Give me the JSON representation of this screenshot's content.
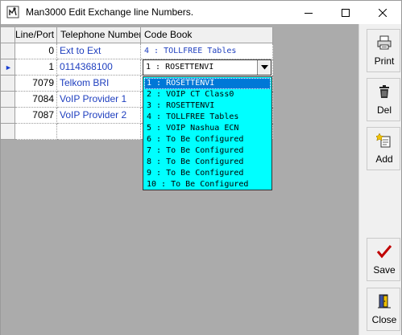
{
  "window": {
    "title": "Man3000 Edit Exchange line Numbers.",
    "buttons": {
      "minimize": "minimize",
      "maximize": "maximize",
      "close": "close"
    }
  },
  "grid": {
    "headers": {
      "line_port": "Line/Port",
      "telephone": "Telephone Number",
      "code_book": "Code Book"
    },
    "rows": [
      {
        "line": "0",
        "telephone": "Ext to Ext",
        "code_book": "4 : TOLLFREE Tables",
        "current": false
      },
      {
        "line": "1",
        "telephone": "0114368100",
        "code_book": "",
        "current": true
      },
      {
        "line": "7079",
        "telephone": "Telkom BRI",
        "code_book": "",
        "current": false
      },
      {
        "line": "7084",
        "telephone": "VoIP Provider 1",
        "code_book": "",
        "current": false
      },
      {
        "line": "7087",
        "telephone": "VoIP Provider 2",
        "code_book": "",
        "current": false
      },
      {
        "line": "",
        "telephone": "",
        "code_book": "",
        "current": false
      }
    ],
    "current_row_indicator": "►"
  },
  "combo": {
    "value": "1 : ROSETTENVI",
    "options": [
      "1 : ROSETTENVI",
      "2 : VOIP CT Class0",
      "3 : ROSETTENVI",
      "4 : TOLLFREE Tables",
      "5 : VOIP Nashua ECN",
      "6 : To Be Configured",
      "7 : To Be Configured",
      "8 : To Be Configured",
      "9 : To Be Configured",
      "10 : To Be Configured"
    ],
    "selected_index": 0
  },
  "toolbar": {
    "print": {
      "label": "Print",
      "icon": "printer-icon"
    },
    "del": {
      "label": "Del",
      "icon": "trash-icon"
    },
    "add": {
      "label": "Add",
      "icon": "add-record-icon"
    },
    "save": {
      "label": "Save",
      "icon": "checkmark-icon"
    },
    "close": {
      "label": "Close",
      "icon": "exit-door-icon"
    }
  },
  "colors": {
    "grid_background": "#ababab",
    "link_text": "#1f3fbf",
    "dropdown_background": "#00ffff",
    "selection": "#0078d7"
  }
}
